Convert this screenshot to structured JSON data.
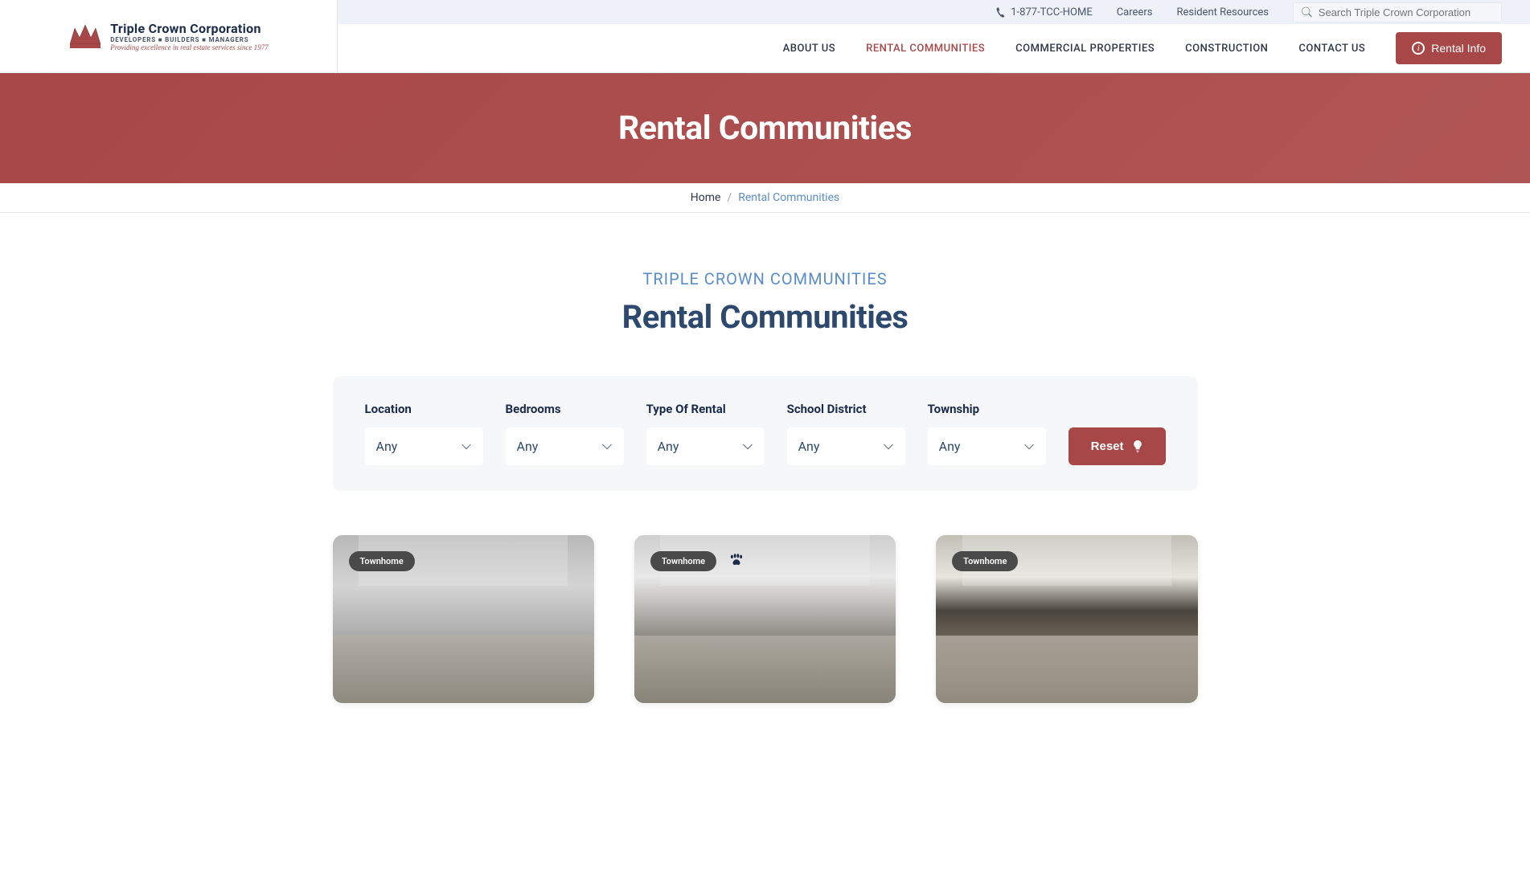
{
  "top_bar": {
    "phone": "1-877-TCC-HOME",
    "careers": "Careers",
    "resident": "Resident Resources",
    "search_placeholder": "Search Triple Crown Corporation"
  },
  "logo": {
    "name": "Triple Crown Corporation",
    "sub": "DEVELOPERS ■ BUILDERS ■ MANAGERS",
    "script": "Providing excellence in real estate services since 1977"
  },
  "nav": {
    "items": [
      {
        "label": "ABOUT US",
        "active": false
      },
      {
        "label": "RENTAL COMMUNITIES",
        "active": true
      },
      {
        "label": "COMMERCIAL PROPERTIES",
        "active": false
      },
      {
        "label": "CONSTRUCTION",
        "active": false
      },
      {
        "label": "CONTACT US",
        "active": false
      }
    ],
    "rental_info": "Rental Info"
  },
  "hero": {
    "title": "Rental Communities"
  },
  "breadcrumb": {
    "home": "Home",
    "sep": "/",
    "current": "Rental Communities"
  },
  "section": {
    "eyebrow": "TRIPLE CROWN COMMUNITIES",
    "title": "Rental Communities"
  },
  "filters": {
    "items": [
      {
        "label": "Location",
        "value": "Any"
      },
      {
        "label": "Bedrooms",
        "value": "Any"
      },
      {
        "label": "Type Of Rental",
        "value": "Any"
      },
      {
        "label": "School District",
        "value": "Any"
      },
      {
        "label": "Township",
        "value": "Any"
      }
    ],
    "reset": "Reset"
  },
  "cards": [
    {
      "badge": "Townhome",
      "pet": false
    },
    {
      "badge": "Townhome",
      "pet": true
    },
    {
      "badge": "Townhome",
      "pet": false
    }
  ]
}
